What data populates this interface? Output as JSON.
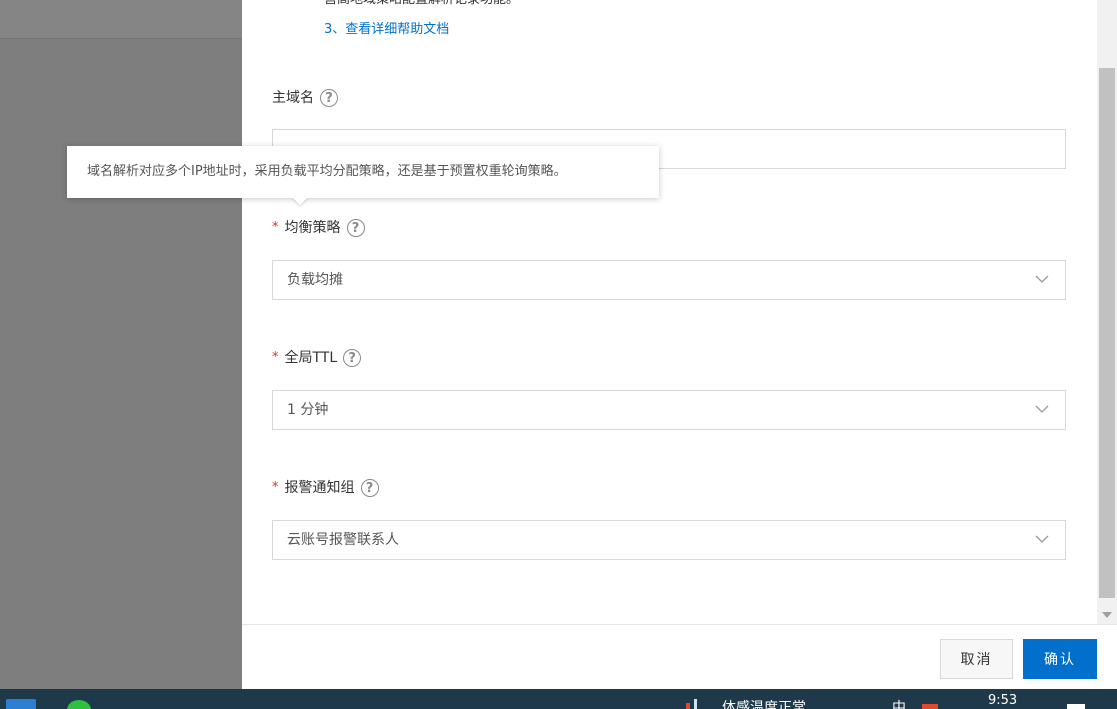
{
  "help": {
    "partial_line": "营高地域策略配置解析记录功能。",
    "doc_link": "3、查看详细帮助文档"
  },
  "fields": {
    "primary_domain": {
      "label": "主域名",
      "value": ""
    },
    "balance_policy": {
      "label": "均衡策略",
      "required_mark": "*",
      "value": "负载均摊"
    },
    "global_ttl": {
      "label": "全局TTL",
      "required_mark": "*",
      "value": "1 分钟"
    },
    "alarm_group": {
      "label": "报警通知组",
      "required_mark": "*",
      "value": "云账号报警联系人"
    }
  },
  "tooltip": {
    "text": "域名解析对应多个IP地址时，采用负载平均分配策略，还是基于预置权重轮询策略。"
  },
  "icons": {
    "help": "help-circle-icon",
    "chevron": "chevron-down-icon"
  },
  "footer": {
    "cancel_label": "取消",
    "confirm_label": "确认"
  },
  "taskbar": {
    "weather_text": "体感温度正常",
    "input_method": "中",
    "time": "9:53"
  },
  "colors": {
    "primary": "#0070cc",
    "required": "#d93026",
    "overlay": "#000000"
  }
}
